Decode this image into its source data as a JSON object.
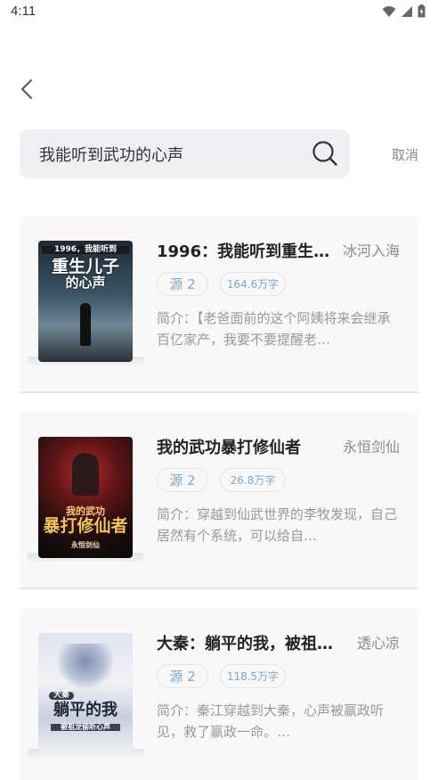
{
  "status_bar": {
    "time": "4:11",
    "icons": [
      "wifi-icon",
      "signal-icon",
      "battery-icon"
    ]
  },
  "search": {
    "query": "我能听到武功的心声",
    "cancel_label": "取消"
  },
  "colors": {
    "tag_text": "#7fa7c9",
    "card_bg": "#f8f8f9",
    "search_bg": "#eef0f3"
  },
  "results": [
    {
      "title": "1996：我能听到重生儿…",
      "author": "冰河入海",
      "source": "源 2",
      "word_count": "164.6万字",
      "intro": "简介：【老爸面前的这个阿姨将来会继承百亿家产，我要不要提醒老…",
      "cover_text": [
        "1996，我能听到",
        "重生儿子",
        "的心声"
      ]
    },
    {
      "title": "我的武功暴打修仙者",
      "author": "永恒剑仙",
      "source": "源 2",
      "word_count": "26.8万字",
      "intro": "简介：穿越到仙武世界的李牧发现，自己居然有个系统，可以给自…",
      "cover_text": [
        "我的武功",
        "暴打修仙者",
        "永恒剑仙"
      ]
    },
    {
      "title": "大秦：躺平的我，被祖…",
      "author": "透心凉",
      "source": "源 2",
      "word_count": "118.5万字",
      "intro": "简介：秦江穿越到大秦，心声被嬴政听见，救了嬴政一命。…",
      "cover_text": [
        "大秦",
        "躺平的我",
        "被祖龙偷听心声"
      ]
    }
  ]
}
